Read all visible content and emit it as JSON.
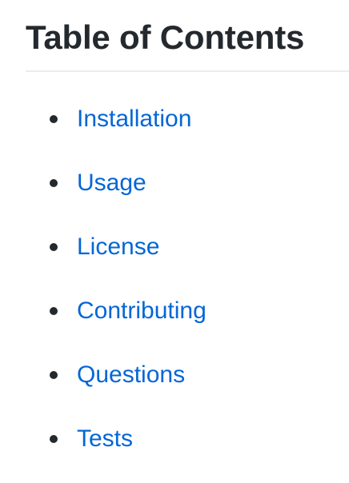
{
  "toc": {
    "title": "Table of Contents",
    "items": [
      {
        "label": "Installation"
      },
      {
        "label": "Usage"
      },
      {
        "label": "License"
      },
      {
        "label": "Contributing"
      },
      {
        "label": "Questions"
      },
      {
        "label": "Tests"
      }
    ]
  },
  "colors": {
    "text": "#24292e",
    "link": "#0366d6",
    "divider": "#eaecef"
  }
}
